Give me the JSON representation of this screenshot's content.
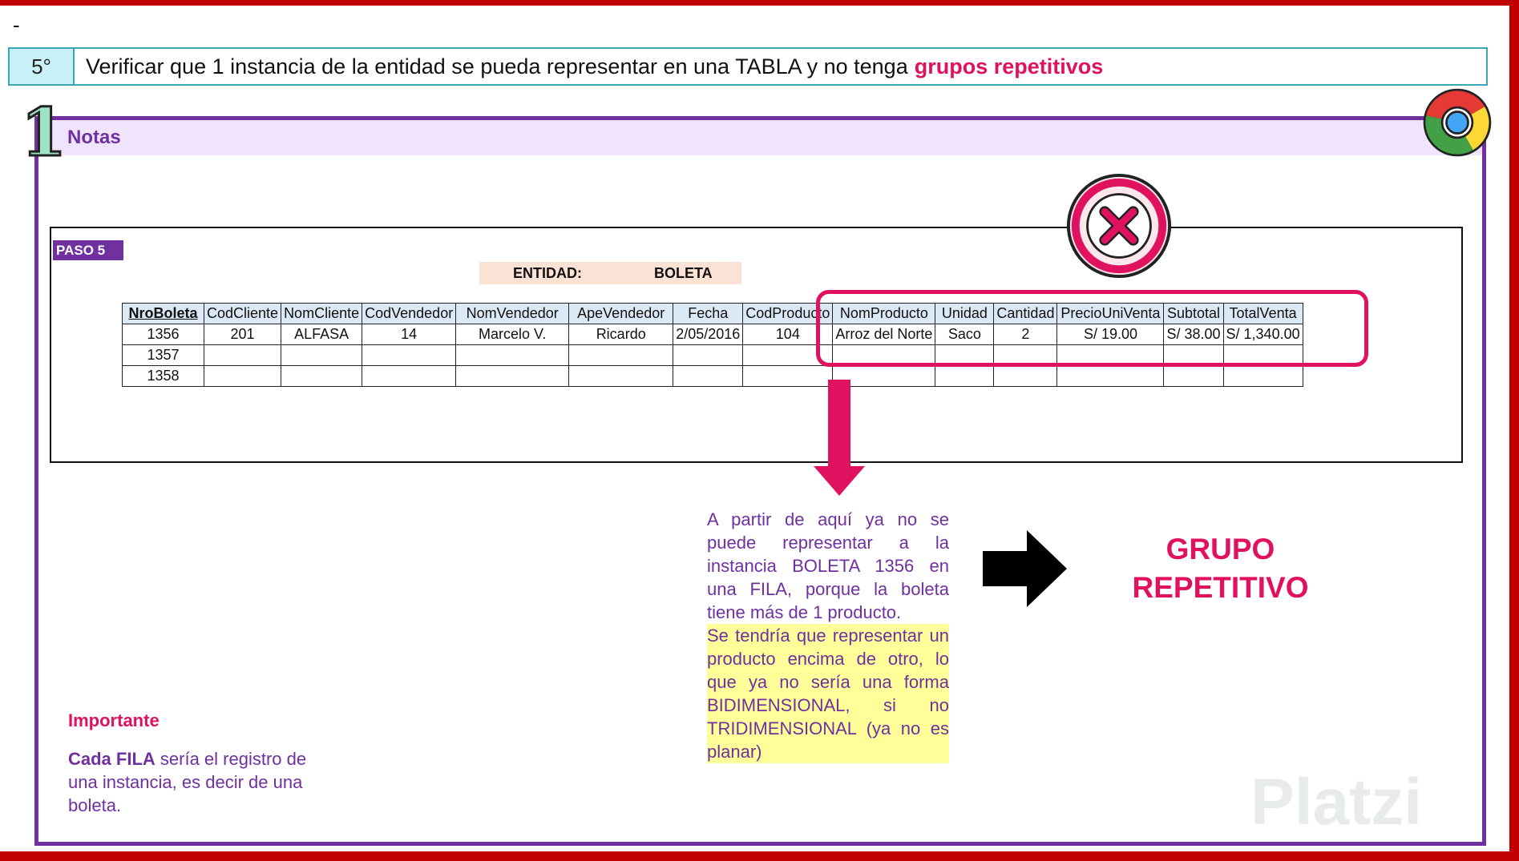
{
  "dash": "-",
  "step": {
    "number": "5°",
    "text": "Verificar que 1 instancia de la entidad se pueda representar en una TABLA y no tenga",
    "highlight": "grupos repetitivos"
  },
  "notes": {
    "badge": "1",
    "label": "Notas"
  },
  "sheet": {
    "paso": "PASO 5",
    "entidad_label": "ENTIDAD:",
    "entidad_value": "BOLETA",
    "columns": [
      "NroBoleta",
      "CodCliente",
      "NomCliente",
      "CodVendedor",
      "NomVendedor",
      "ApeVendedor",
      "Fecha",
      "CodProducto",
      "NomProducto",
      "Unidad",
      "Cantidad",
      "PrecioUniVenta",
      "Subtotal",
      "TotalVenta"
    ],
    "rows": [
      [
        "1356",
        "201",
        "ALFASA",
        "14",
        "Marcelo V.",
        "Ricardo",
        "2/05/2016",
        "104",
        "Arroz del Norte",
        "Saco",
        "2",
        "S/ 19.00",
        "S/ 38.00",
        "S/ 1,340.00"
      ],
      [
        "1357",
        "",
        "",
        "",
        "",
        "",
        "",
        "",
        "",
        "",
        "",
        "",
        "",
        ""
      ],
      [
        "1358",
        "",
        "",
        "",
        "",
        "",
        "",
        "",
        "",
        "",
        "",
        "",
        "",
        ""
      ]
    ]
  },
  "paragraph": {
    "normal": "A partir de aquí ya no se puede representar a la instancia BOLETA 1356 en una FILA, porque la boleta tiene más de 1 producto.",
    "highlighted": "Se tendría que representar un producto encima de otro, lo que ya no sería una forma BIDIMENSIONAL, si no TRIDIMENSIONAL (ya no es planar)"
  },
  "grupo": {
    "line1": "GRUPO",
    "line2": "REPETITIVO"
  },
  "importante": {
    "title": "Importante",
    "bold": "Cada FILA",
    "text": " sería el registro de una instancia, es decir de una boleta."
  },
  "watermark": "Platzi",
  "colors": {
    "frame": "#c00000",
    "accent_pink": "#e0115f",
    "accent_purple": "#7030a0",
    "step_border": "#3aa6b6"
  },
  "icons": [
    "chrome-icon",
    "error-x-icon",
    "down-arrow-icon",
    "right-arrow-icon"
  ]
}
